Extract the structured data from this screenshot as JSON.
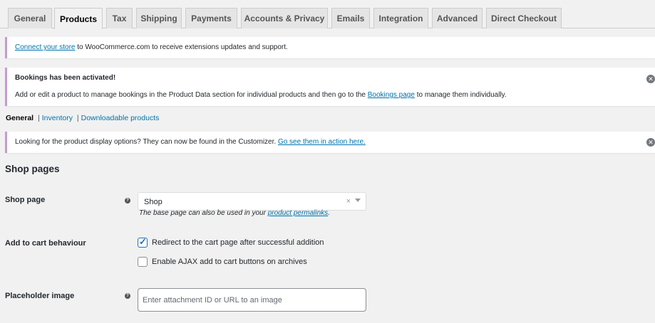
{
  "tabs": [
    "General",
    "Products",
    "Tax",
    "Shipping",
    "Payments",
    "Accounts & Privacy",
    "Emails",
    "Integration",
    "Advanced",
    "Direct Checkout"
  ],
  "active_tab": "Products",
  "connect_notice": {
    "link": "Connect your store",
    "text": " to WooCommerce.com to receive extensions updates and support."
  },
  "bookings_notice": {
    "title": "Bookings has been activated!",
    "text_before": "Add or edit a product to manage bookings in the Product Data section for individual products and then go to the ",
    "link": "Bookings page",
    "text_after": " to manage them individually."
  },
  "subnav": {
    "current": "General",
    "links": [
      "Inventory",
      "Downloadable products"
    ],
    "separator": "|"
  },
  "display_notice": {
    "text": "Looking for the product display options? They can now be found in the Customizer. ",
    "link": "Go see them in action here."
  },
  "section_title": "Shop pages",
  "shop_page": {
    "label": "Shop page",
    "value": "Shop",
    "clear": "×",
    "desc_before": "The base page can also be used in your ",
    "desc_link": "product permalinks",
    "desc_after": "."
  },
  "add_to_cart": {
    "label": "Add to cart behaviour",
    "options": [
      {
        "label": "Redirect to the cart page after successful addition",
        "checked": true
      },
      {
        "label": "Enable AJAX add to cart buttons on archives",
        "checked": false
      }
    ]
  },
  "placeholder_image": {
    "label": "Placeholder image",
    "placeholder": "Enter attachment ID or URL to an image"
  },
  "icons": {
    "help": "question-mark-circle-icon",
    "dismiss": "dismiss-icon",
    "check": "checkmark-icon"
  },
  "colors": {
    "notice_border": "#c69bd1",
    "link": "#0073aa",
    "checkbox_accent": "#2271b1"
  }
}
